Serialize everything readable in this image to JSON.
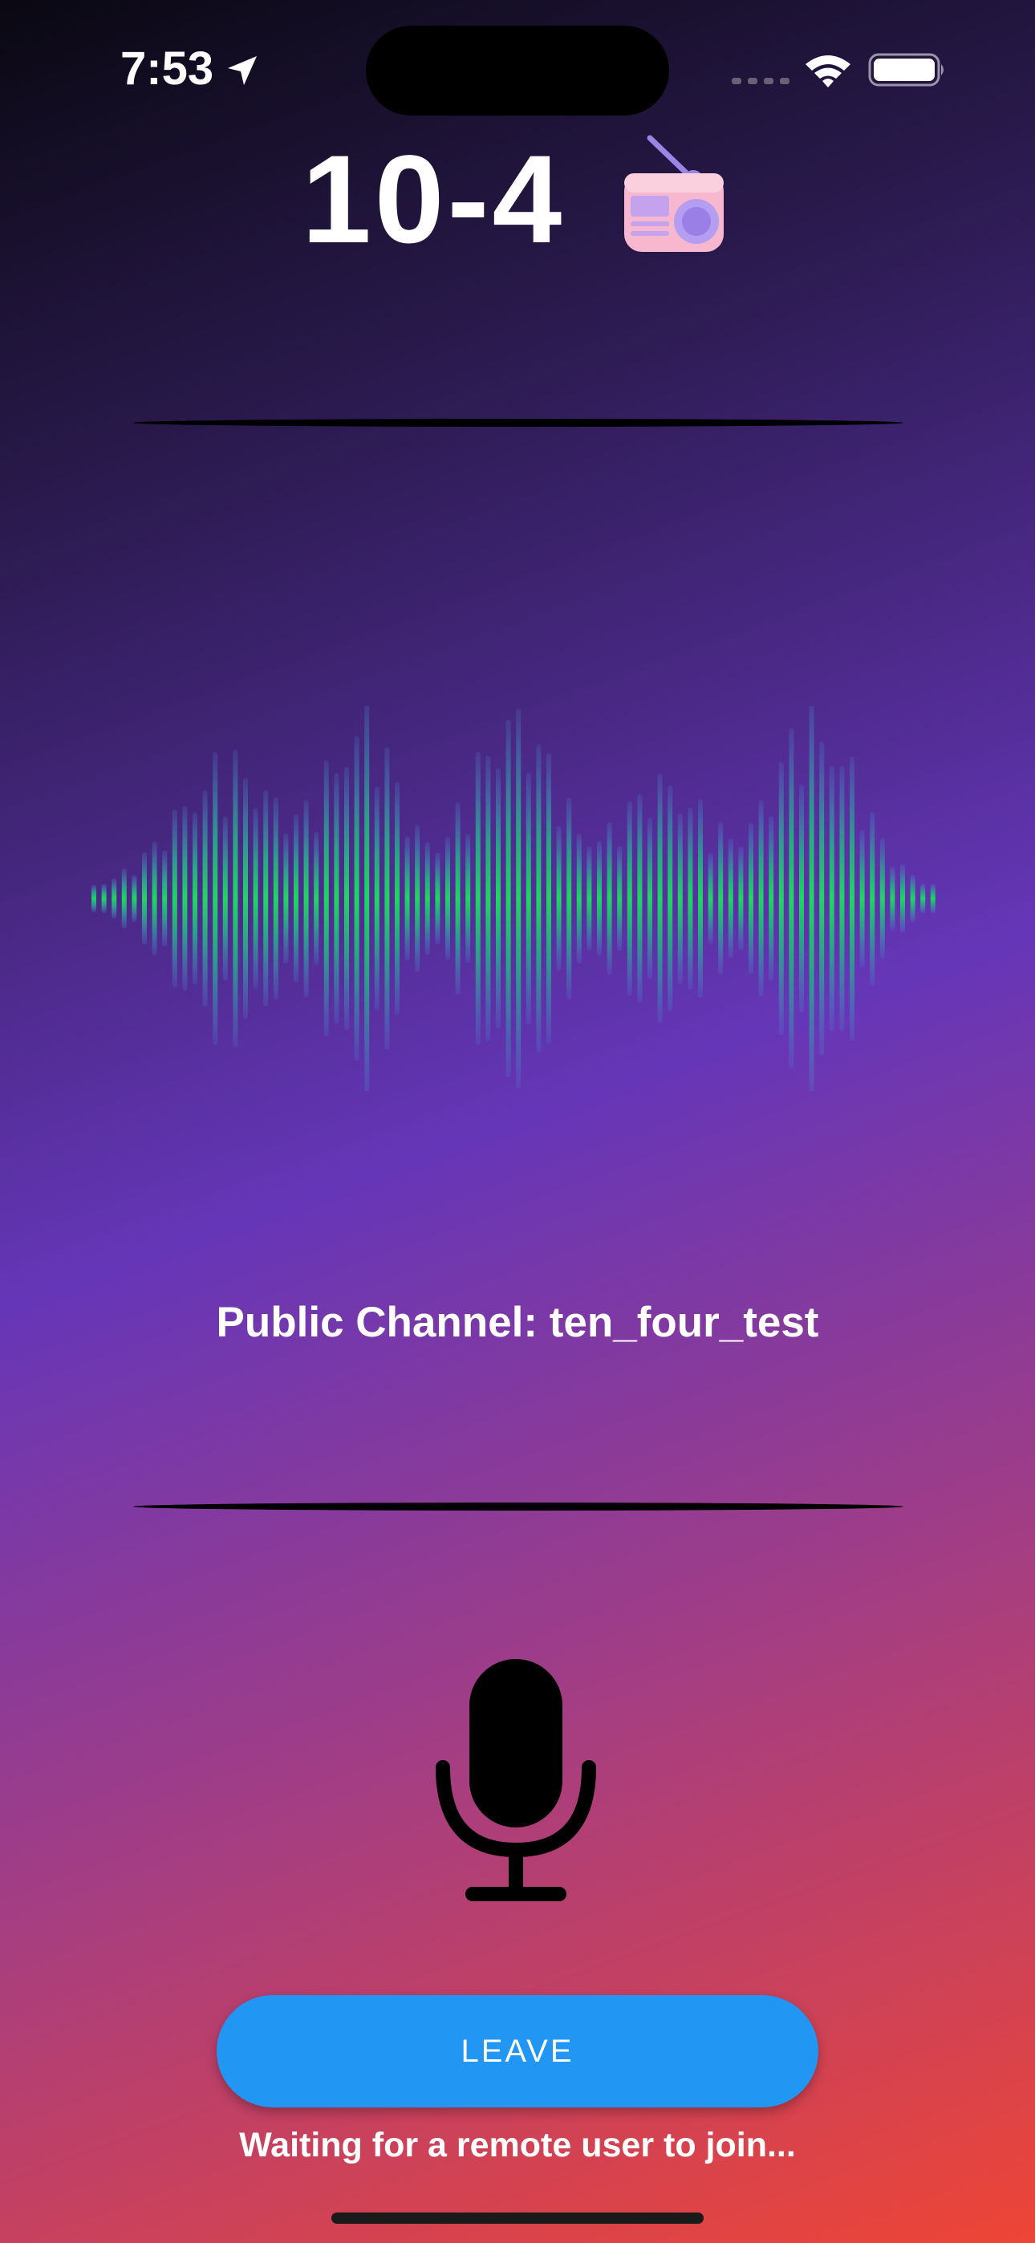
{
  "status_bar": {
    "time": "7:53"
  },
  "header": {
    "title": "10-4",
    "radio_icon": "radio-icon"
  },
  "channel": {
    "label": "Public Channel: ten_four_test"
  },
  "controls": {
    "mic_icon": "microphone-icon",
    "leave_label": "LEAVE"
  },
  "status": {
    "message": "Waiting for a remote user to join..."
  },
  "colors": {
    "button": "#2196f3",
    "waveform_green": "#1ed760",
    "waveform_teal": "#3a9aa0"
  }
}
